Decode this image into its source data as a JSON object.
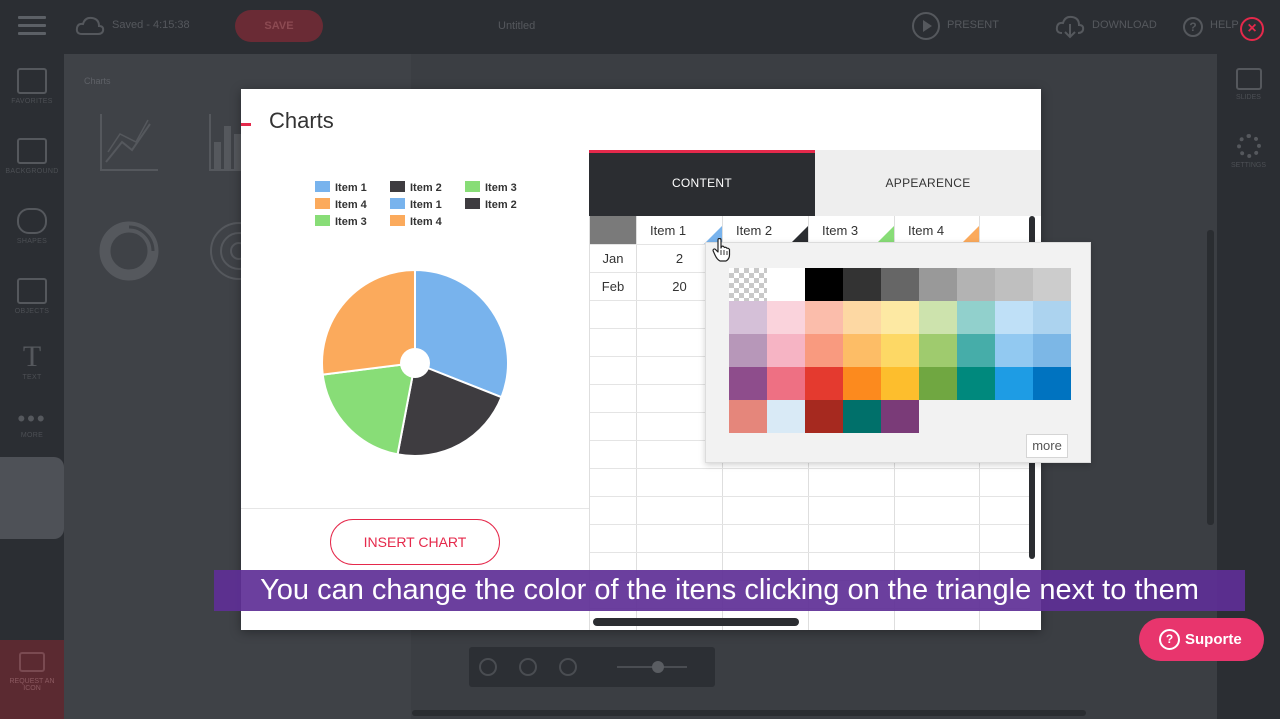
{
  "app": {
    "saved_text": "Saved - 4:15:38",
    "save_label": "SAVE",
    "doc_title": "Untitled",
    "present_label": "PRESENT",
    "download_label": "DOWNLOAD",
    "help_label": "HELP"
  },
  "left_nav": {
    "items": [
      {
        "label": "FAVORITES",
        "icon": "star-folder-icon"
      },
      {
        "label": "BACKGROUND",
        "icon": "background-icon"
      },
      {
        "label": "SHAPES",
        "icon": "cloud-shapes-icon"
      },
      {
        "label": "OBJECTS",
        "icon": "objects-icon"
      },
      {
        "label": "TEXT",
        "icon": "text-icon"
      },
      {
        "label": "MORE",
        "icon": "more-icon"
      }
    ],
    "request_label": "REQUEST AN ICON"
  },
  "right_nav": {
    "slides_label": "SLIDES",
    "settings_label": "SETTINGS"
  },
  "panel": {
    "label": "Charts"
  },
  "modal": {
    "title": "Charts",
    "insert_button": "INSERT CHART",
    "tabs": [
      {
        "label": "CONTENT",
        "active": true
      },
      {
        "label": "APPEARENCE",
        "active": false
      }
    ],
    "legend": [
      {
        "label": "Item 1",
        "color": "#78b3ed"
      },
      {
        "label": "Item 2",
        "color": "#3e3c40"
      },
      {
        "label": "Item 3",
        "color": "#88dd77"
      },
      {
        "label": "Item 4",
        "color": "#fbaa5c"
      },
      {
        "label": "Item 1",
        "color": "#78b3ed"
      },
      {
        "label": "Item 2",
        "color": "#3e3c40"
      },
      {
        "label": "Item 3",
        "color": "#88dd77"
      },
      {
        "label": "Item 4",
        "color": "#fbaa5c"
      }
    ],
    "grid": {
      "columns": [
        {
          "label": "Item 1",
          "color": "#78b3ed"
        },
        {
          "label": "Item 2",
          "color": "#2b2d31"
        },
        {
          "label": "Item 3",
          "color": "#88dd77"
        },
        {
          "label": "Item 4",
          "color": "#fbaa5c"
        }
      ],
      "rows": [
        {
          "label": "Jan",
          "values": [
            "2"
          ]
        },
        {
          "label": "Feb",
          "values": [
            "20"
          ]
        }
      ]
    },
    "picker": {
      "more_label": "more",
      "swatches": [
        [
          "transparent",
          "#ffffff",
          "#000000",
          "#333333",
          "#666666",
          "#999999",
          "#b3b3b3",
          "#bfbfbf",
          "#cccccc"
        ],
        [
          "#d5c0d8",
          "#fad3dc",
          "#fbbdab",
          "#fdd8a3",
          "#fde9a3",
          "#cde3ad",
          "#91d0cc",
          "#bfe0f7",
          "#acd3ef"
        ],
        [
          "#b797b9",
          "#f6b4c4",
          "#f99a7f",
          "#fdbd66",
          "#fdd865",
          "#9fcb6e",
          "#46ada9",
          "#92c9f1",
          "#7cb7e6"
        ],
        [
          "#8e4d8c",
          "#ee7083",
          "#e43a2f",
          "#fc8a1e",
          "#fdbe2d",
          "#70a741",
          "#00897d",
          "#1e9ce4",
          "#0073c0"
        ],
        [
          "#e5867b",
          "#d9eaf6",
          "#a6291f",
          "#00706a",
          "#7a3b78"
        ]
      ]
    }
  },
  "chart_data": {
    "type": "pie",
    "title": "",
    "categories": [
      "Item 1",
      "Item 2",
      "Item 3",
      "Item 4"
    ],
    "values": [
      31,
      22,
      20,
      27
    ],
    "colors": [
      "#78b3ed",
      "#3e3c40",
      "#88dd77",
      "#fbaa5c"
    ],
    "donut_hole": true,
    "legend_position": "top"
  },
  "caption": "You can change the color of the itens clicking on the triangle next to them",
  "support_label": "Suporte"
}
